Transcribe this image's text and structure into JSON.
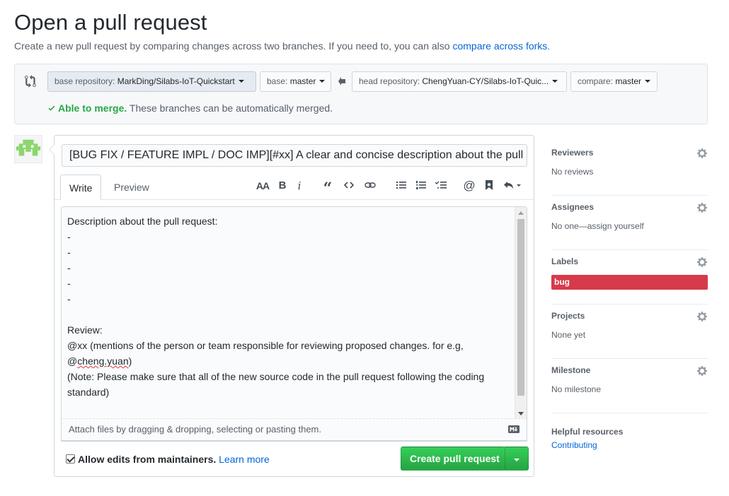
{
  "header": {
    "title": "Open a pull request",
    "subtitle_pre": "Create a new pull request by comparing changes across two branches. If you need to, you can also ",
    "subtitle_link": "compare across forks",
    "subtitle_post": "."
  },
  "range": {
    "base_repo_label": "base repository: ",
    "base_repo_value": "MarkDing/Silabs-IoT-Quickstart",
    "base_label": "base: ",
    "base_value": "master",
    "head_repo_label": "head repository: ",
    "head_repo_value": "ChengYuan-CY/Silabs-IoT-Quic...",
    "compare_label": "compare: ",
    "compare_value": "master",
    "merge_status": "Able to merge.",
    "merge_detail": " These branches can be automatically merged."
  },
  "composer": {
    "title_value": "[BUG FIX / FEATURE IMPL / DOC IMP][#xx] A clear and concise description about the pull request",
    "tabs": [
      {
        "label": "Write",
        "active": true
      },
      {
        "label": "Preview",
        "active": false
      }
    ],
    "toolbar_icons": [
      "text-size-icon",
      "bold-icon",
      "italic-icon",
      "quote-icon",
      "code-icon",
      "link-icon",
      "unordered-list-icon",
      "ordered-list-icon",
      "task-list-icon",
      "mention-icon",
      "saved-reply-icon",
      "reply-icon"
    ],
    "body_part1": "Description about the pull request:\n-\n-\n-\n-\n-\n\nReview:\n@xx (mentions of the person or team responsible for reviewing proposed changes. for e.g,\n@",
    "body_squiggle": "cheng.yuan",
    "body_part2": ")\n(Note: Please make sure that all of the new source code in the pull request following the coding standard)",
    "drop_hint": "Attach files by dragging & dropping, selecting or pasting them.",
    "allow_edits_label": "Allow edits from maintainers.",
    "learn_more": "Learn more",
    "allow_edits_checked": true,
    "submit_label": "Create pull request"
  },
  "sidebar": {
    "sections": [
      {
        "heading": "Reviewers",
        "value": "No reviews"
      },
      {
        "heading": "Assignees",
        "value": "No one—assign yourself"
      },
      {
        "heading": "Labels",
        "label": "bug",
        "label_color": "#d73a4a"
      },
      {
        "heading": "Projects",
        "value": "None yet"
      },
      {
        "heading": "Milestone",
        "value": "No milestone"
      }
    ],
    "resources_heading": "Helpful resources",
    "resources_link": "Contributing"
  },
  "colors": {
    "accent_link": "#0366d6",
    "success": "#28a745",
    "label_bug": "#d73a4a"
  }
}
